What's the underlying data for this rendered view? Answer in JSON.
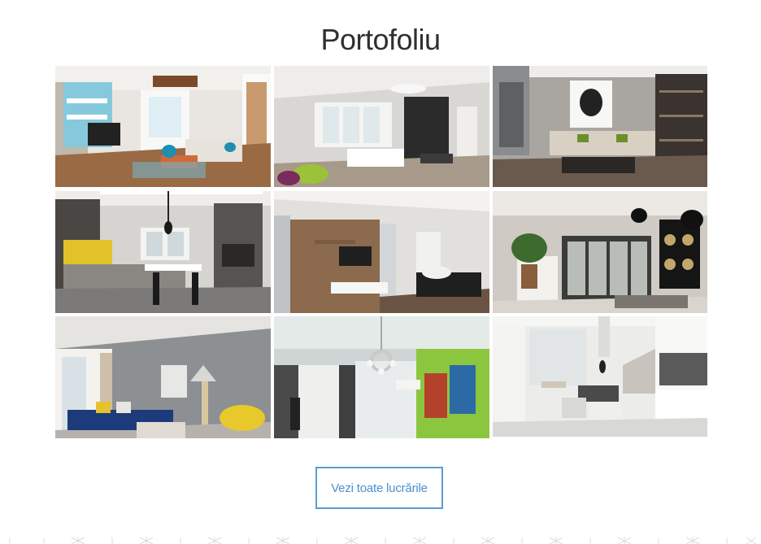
{
  "section": {
    "title": "Portofoliu",
    "view_all_label": "Vezi toate lucrările"
  },
  "portfolio_items": [
    {
      "scene": "living-room-shelves-blue-accent"
    },
    {
      "scene": "open-kitchen-dark-wall"
    },
    {
      "scene": "living-room-portrait-art"
    },
    {
      "scene": "kitchen-yellow-backsplash"
    },
    {
      "scene": "living-room-wood-tv-wall"
    },
    {
      "scene": "living-room-black-wall-lamps"
    },
    {
      "scene": "living-room-blue-sofa-yellow-chair"
    },
    {
      "scene": "room-green-wall-posters"
    },
    {
      "scene": "white-kitchen-island"
    }
  ],
  "colors": {
    "accent": "#5b9bd5",
    "title": "#2f2f2f"
  }
}
